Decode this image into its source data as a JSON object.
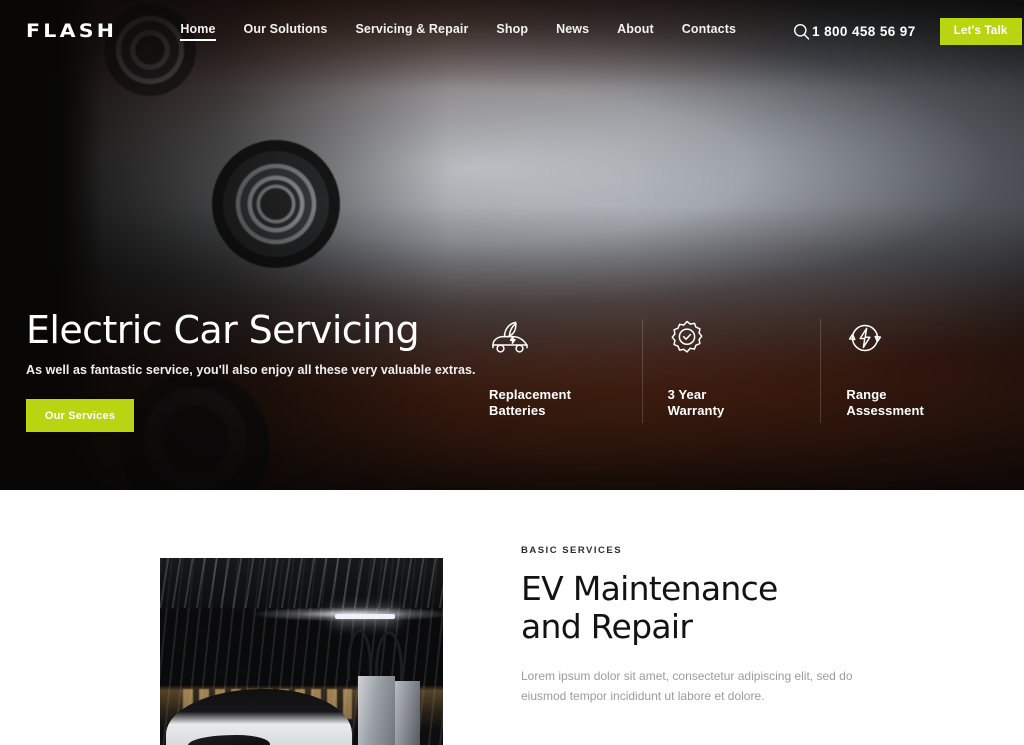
{
  "brand": {
    "logo": "FLASH",
    "accent_color": "#b9d411",
    "hero_bg_color": "#171311"
  },
  "header": {
    "nav": [
      {
        "label": "Home",
        "active": true
      },
      {
        "label": "Our Solutions",
        "active": false
      },
      {
        "label": "Servicing & Repair",
        "active": false
      },
      {
        "label": "Shop",
        "active": false
      },
      {
        "label": "News",
        "active": false
      },
      {
        "label": "About",
        "active": false
      },
      {
        "label": "Contacts",
        "active": false
      }
    ],
    "search_icon": "search-icon",
    "phone": "1 800 458 56 97",
    "cta_label": "Let's Talk"
  },
  "hero": {
    "title": "Electric Car Servicing",
    "subtitle": "As well as fantastic service, you'll also enjoy all these very valuable extras.",
    "cta_label": "Our Services",
    "features": [
      {
        "icon": "eco-car-icon",
        "label": "Replacement\nBatteries"
      },
      {
        "icon": "badge-check-icon",
        "label": "3 Year\nWarranty"
      },
      {
        "icon": "lightning-refresh-icon",
        "label": "Range\nAssessment"
      }
    ]
  },
  "services": {
    "eyebrow": "BASIC SERVICES",
    "title": "EV Maintenance\nand Repair",
    "body": "Lorem ipsum dolor sit amet, consectetur adipiscing elit, sed do\neiusmod tempor incididunt ut labore et dolore.",
    "image_alt": "ev-charging-station-photo"
  }
}
